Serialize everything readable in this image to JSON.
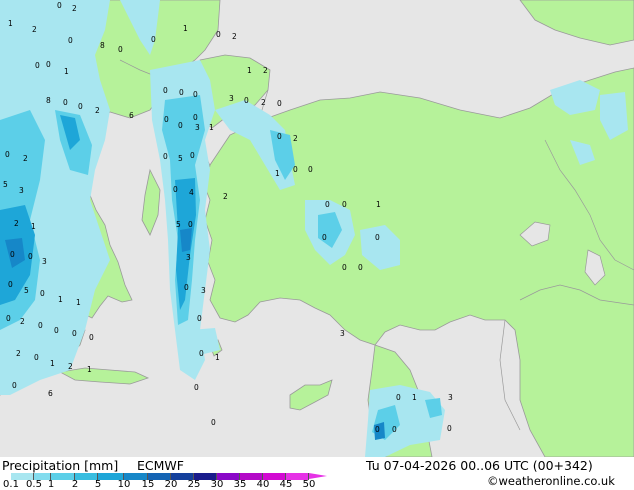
{
  "footer": {
    "title": "Precipitation [mm]",
    "model": "ECMWF",
    "datetime": "Tu 07-04-2026 00..06 UTC (00+342)",
    "credit": "©weatheronline.co.uk"
  },
  "legend": {
    "ticks": [
      "0.1",
      "0.5",
      "1",
      "2",
      "5",
      "10",
      "15",
      "20",
      "25",
      "30",
      "35",
      "40",
      "45",
      "50"
    ],
    "colors": [
      "#a8e6f0",
      "#82dcee",
      "#5ccfe8",
      "#38bde0",
      "#1ea6d8",
      "#1687c8",
      "#1464b4",
      "#14409c",
      "#1a1c8c",
      "#8a08c8",
      "#b40ac8",
      "#d20ad2",
      "#e632e6"
    ]
  },
  "map": {
    "land_color": "#b6f29a",
    "sea_color": "#e6e6e6",
    "border_color": "#9a9a9a",
    "precip_labels": [
      "0",
      "2",
      "1",
      "2",
      "0",
      "8",
      "0",
      "0",
      "1",
      "0",
      "2",
      "0",
      "1",
      "0",
      "1",
      "2",
      "0",
      "0",
      "0",
      "3",
      "0",
      "2",
      "0",
      "8",
      "0",
      "0",
      "2",
      "6",
      "0",
      "1",
      "0",
      "0",
      "3",
      "0",
      "5",
      "0",
      "0",
      "2",
      "1",
      "0",
      "0",
      "0",
      "2",
      "5",
      "3",
      "2",
      "1",
      "0",
      "0",
      "3",
      "0",
      "5",
      "0",
      "1",
      "1",
      "0",
      "4",
      "2",
      "5",
      "0",
      "0",
      "0",
      "1",
      "0",
      "0",
      "0",
      "0",
      "3",
      "0",
      "3",
      "0",
      "2",
      "0",
      "0",
      "0",
      "0",
      "2",
      "0",
      "1",
      "2",
      "1",
      "0",
      "6",
      "0",
      "0",
      "1",
      "0",
      "0",
      "3",
      "0",
      "1",
      "3",
      "0",
      "0",
      "0",
      "0",
      "0",
      "0",
      "0",
      "2",
      "0",
      "0",
      "0",
      "0",
      "5",
      "1",
      "5",
      "0",
      "0",
      "0",
      "1",
      "0",
      "2",
      "0",
      "5",
      "0"
    ]
  }
}
